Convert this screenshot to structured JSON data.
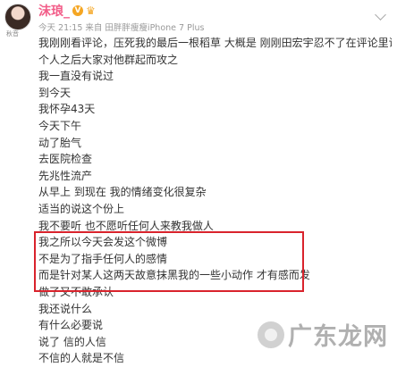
{
  "post": {
    "avatar_label": "秋音",
    "user_name": "沫琅_",
    "meta": "今天 21:15 来自 田胖胖瘦瘦iPhone 7 Plus",
    "lines": [
      "我刚刚看评论，压死我的最后一根稻草 大概是 刚刚田宏宇忍不了在评论里说了一",
      "个人之后大家对他群起而攻之",
      "我一直没有说过",
      "到今天",
      "我怀孕43天",
      "今天下午",
      "动了胎气",
      "去医院检查",
      "先兆性流产",
      "从早上 到现在 我的情绪变化很复杂",
      "适当的说这个份上",
      "我不要听 也不愿听任何人来教我做人",
      "我之所以今天会发这个微博",
      "不是为了指手任何人的感情",
      "而是针对某人这两天故意抹黑我的一些小动作 才有感而发",
      "做了又不敢承认",
      "我还说什么",
      "有什么必要说",
      "说了 信的人信",
      "不信的人就是不信"
    ]
  },
  "watermark": {
    "text": "广东龙网"
  },
  "colors": {
    "username": "#f25c88",
    "highlight_border": "#d9232c"
  }
}
